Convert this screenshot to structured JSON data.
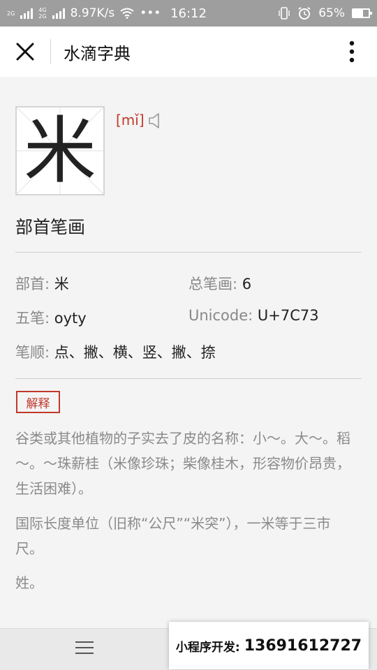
{
  "status_bar": {
    "net_top": "2G",
    "net_mid": "4G",
    "net_bottom": "2G",
    "speed": "8.97K/s",
    "dots": "•••",
    "time": "16:12",
    "battery": "65%",
    "battery_level": 0.65,
    "icons": [
      "signal-icon",
      "wifi-icon",
      "vibrate-icon",
      "alarm-icon",
      "battery-icon"
    ]
  },
  "nav": {
    "title": "水滴字典",
    "close_icon": "close-icon",
    "more_icon": "more-vertical-icon"
  },
  "character": {
    "glyph": "米",
    "pinyin": "[mǐ]",
    "speaker_icon": "speaker-icon"
  },
  "section_title": "部首笔画",
  "info": {
    "radical_label": "部首:",
    "radical_value": "米",
    "strokes_label": "总笔画:",
    "strokes_value": "6",
    "wubi_label": "五笔:",
    "wubi_value": "oyty",
    "unicode_label": "Unicode:",
    "unicode_value": "U+7C73",
    "order_label": "笔顺:",
    "order_value": "点、撇、横、竖、撇、捺"
  },
  "explanation": {
    "tag": "解释",
    "paragraphs": [
      "谷类或其他植物的子实去了皮的名称：小～。大～。稻～。～珠薪桂（米像珍珠；柴像桂木，形容物价昂贵，生活困难）。",
      "国际长度单位（旧称“公尺”“米突”），一米等于三市尺。",
      "姓。"
    ]
  },
  "bottom": {
    "menu_icon": "menu-icon",
    "dev_label": "小程序开发:",
    "dev_phone": "13691612727"
  },
  "colors": {
    "accent_red": "#c0392b",
    "status_bar": "#9e9e9e",
    "muted_text": "#8a8a8a"
  }
}
